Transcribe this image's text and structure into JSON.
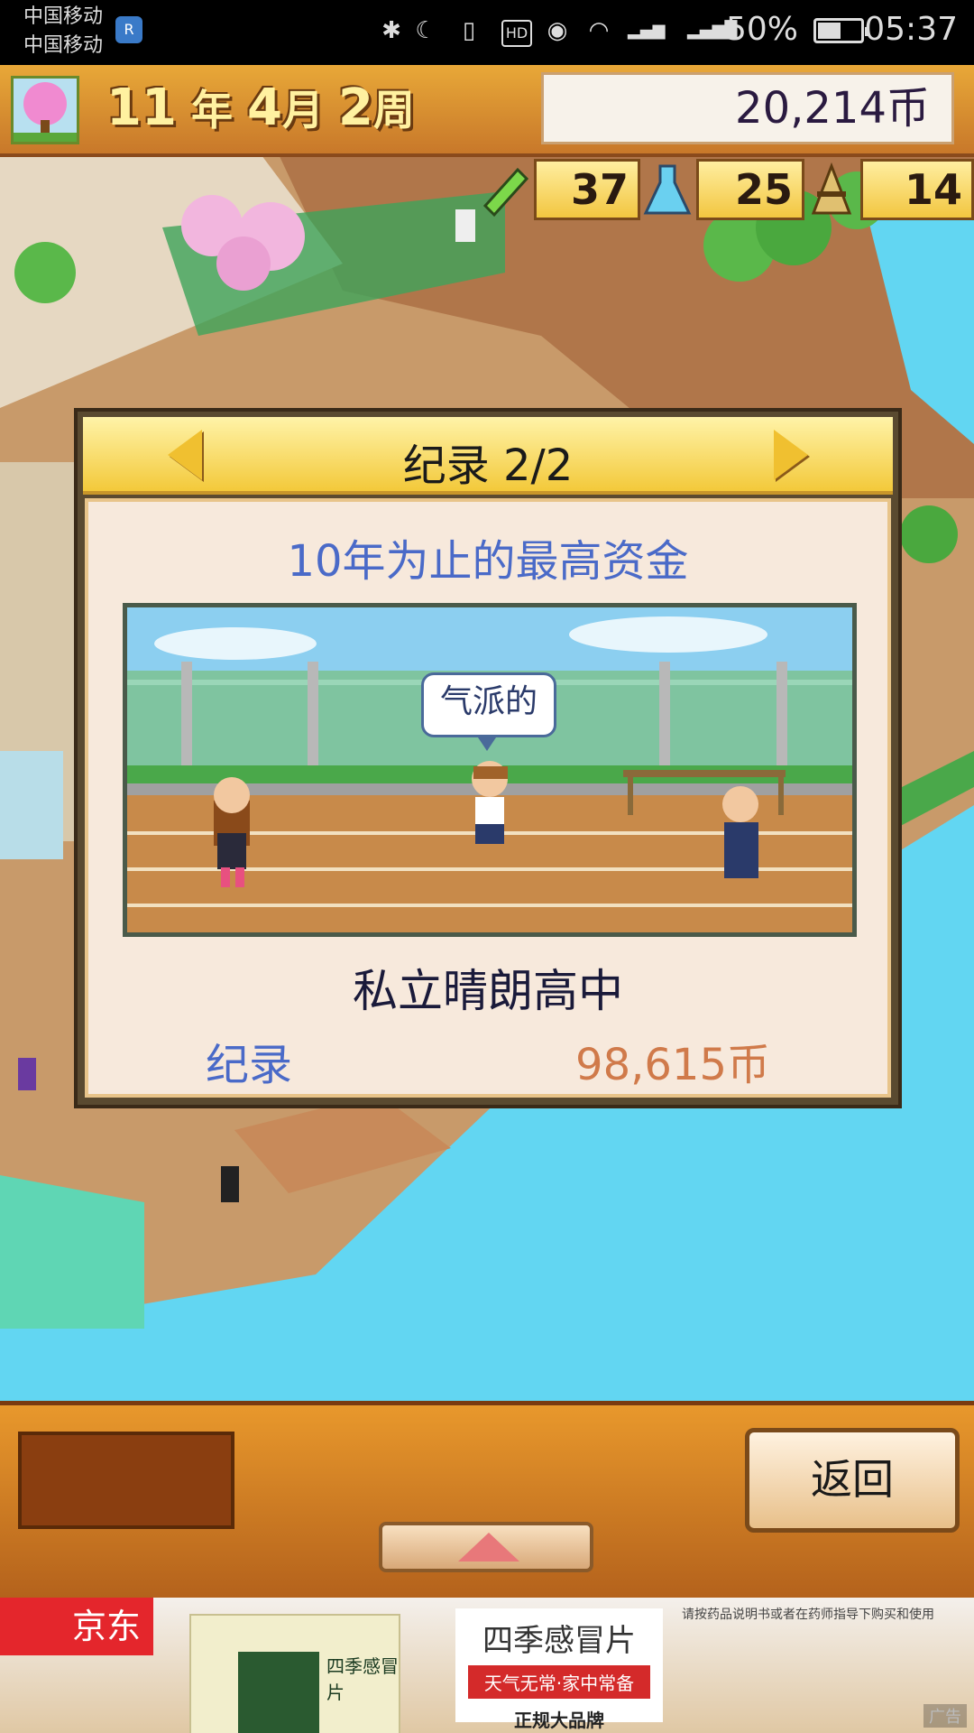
{
  "status_bar": {
    "carrier_1": "中国移动",
    "carrier_2": "中国移动",
    "battery": "50%",
    "time": "05:37",
    "battery_level": 0.5,
    "icons": [
      "bluetooth-icon",
      "moon-icon",
      "vibrate-icon",
      "hd-icon",
      "eye-icon",
      "wifi-icon",
      "signal-2g-icon",
      "signal-4g-icon"
    ]
  },
  "hud": {
    "year_value": "11",
    "year_label": "年",
    "month_value": "4",
    "month_label": "月",
    "week_value": "2",
    "week_label": "周",
    "money": "20,214币",
    "stats": [
      {
        "icon": "pencil-icon",
        "value": "37"
      },
      {
        "icon": "flask-icon",
        "value": "25"
      },
      {
        "icon": "cone-icon",
        "value": "14"
      }
    ]
  },
  "dialog": {
    "title": "纪录 2/2",
    "subtitle": "10年为止的最高资金",
    "speech_bubble": "气派的",
    "school_name": "私立晴朗高中",
    "record_label": "纪录",
    "record_value": "98,615币"
  },
  "bottom_panel": {
    "back_label": "返回"
  },
  "ad": {
    "brand": "京东",
    "product_title": "四季感冒片",
    "slogan": "天气无常·家中常备",
    "tagline": "正规大品牌",
    "disclaimer": "请按药品说明书或者在药师指导下购买和使用",
    "ad_label": "广告"
  },
  "colors": {
    "hud_gold": "#e8a838",
    "dialog_header": "#f3c93a",
    "subtitle_blue": "#4a6ac8",
    "record_value_orange": "#d07a4a",
    "water": "#62d6f2"
  }
}
